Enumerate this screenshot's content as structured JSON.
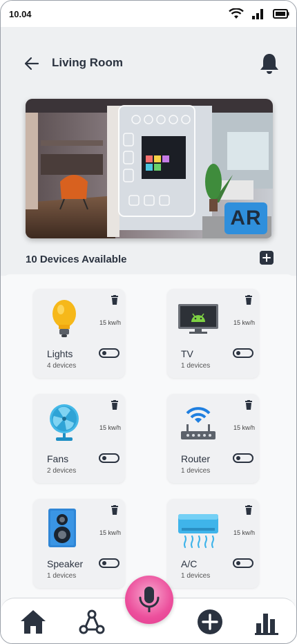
{
  "status": {
    "time": "10.04"
  },
  "header": {
    "title": "Living Room"
  },
  "hero": {
    "badge": "AR"
  },
  "devices": {
    "count_label": "10 Devices Available",
    "items": [
      {
        "name": "Lights",
        "count": "4 devices",
        "power": "15 kw/h",
        "icon": "light-bulb-icon"
      },
      {
        "name": "TV",
        "count": "1 devices",
        "power": "15 kw/h",
        "icon": "tv-icon"
      },
      {
        "name": "Fans",
        "count": "2 devices",
        "power": "15 kw/h",
        "icon": "fan-icon"
      },
      {
        "name": "Router",
        "count": "1 devices",
        "power": "15 kw/h",
        "icon": "router-icon"
      },
      {
        "name": "Speaker",
        "count": "1 devices",
        "power": "15 kw/h",
        "icon": "speaker-icon"
      },
      {
        "name": "A/C",
        "count": "1 devices",
        "power": "15 kw/h",
        "icon": "air-conditioner-icon"
      }
    ]
  },
  "nav": {
    "items": [
      "home-icon",
      "connections-icon",
      "microphone-icon",
      "add-icon",
      "stats-icon"
    ]
  },
  "colors": {
    "primary": "#2b3340",
    "accent": "#ec4f9c",
    "ar_badge": "#2f8fdc"
  }
}
